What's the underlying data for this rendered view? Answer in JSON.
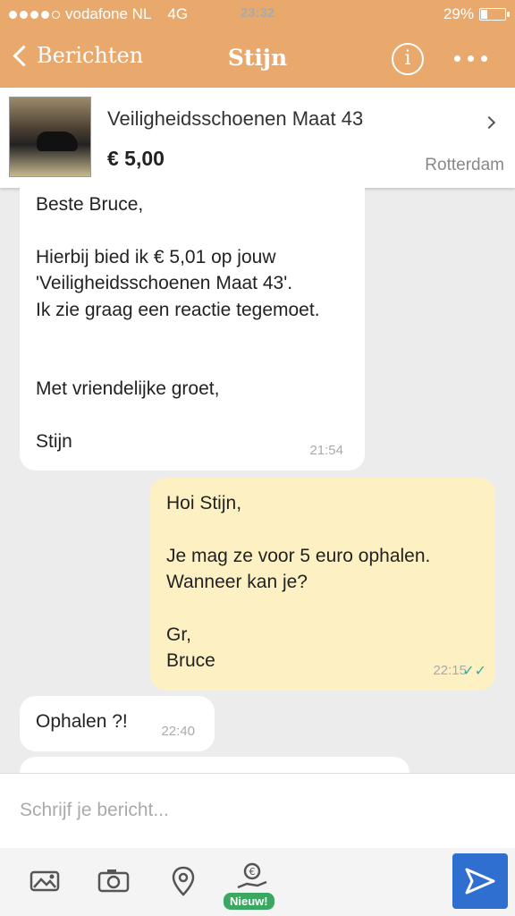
{
  "status": {
    "carrier": "vodafone NL",
    "network": "4G",
    "time": "23:32",
    "battery": "29%",
    "battery_level": 0.29
  },
  "nav": {
    "back_label": "Berichten",
    "title": "Stijn"
  },
  "listing": {
    "title": "Veiligheidsschoenen Maat 43",
    "price": "€ 5,00",
    "location": "Rotterdam"
  },
  "messages": [
    {
      "dir": "in",
      "text": "Beste Bruce,\n\nHierbij bied ik € 5,01 op jouw\n'Veiligheidsschoenen Maat 43'.\nIk zie graag een reactie tegemoet.\n\n\nMet vriendelijke groet,\n\nStijn",
      "time": "21:54"
    },
    {
      "dir": "out",
      "text": "Hoi Stijn,\n\nJe mag ze voor 5 euro ophalen.\nWanneer kan je?\n\nGr,\nBruce",
      "time": "22:15",
      "read": true
    },
    {
      "dir": "in",
      "text": "Ophalen ?!",
      "time": "22:40"
    }
  ],
  "compose": {
    "placeholder": "Schrijf je bericht..."
  },
  "toolbar": {
    "new_badge": "Nieuw!"
  }
}
